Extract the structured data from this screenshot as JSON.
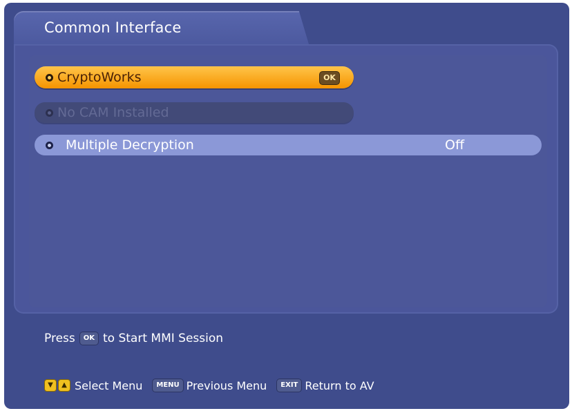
{
  "header": {
    "title": "Common Interface"
  },
  "menu": {
    "items": [
      {
        "label": "CryptoWorks",
        "badge": "OK",
        "state": "selected"
      },
      {
        "label": "No CAM Installed",
        "state": "disabled"
      },
      {
        "label": "Multiple Decryption",
        "value": "Off",
        "state": "normal"
      }
    ]
  },
  "hint": {
    "press": "Press",
    "key": "OK",
    "action": "to Start MMI Session"
  },
  "footer": {
    "select_label": "Select Menu",
    "menu_key": "MENU",
    "previous_label": "Previous Menu",
    "exit_key": "EXIT",
    "return_label": "Return to AV",
    "arrow_down": "▼",
    "arrow_up": "▲"
  },
  "colors": {
    "background": "#3f4c8c",
    "selected": "#f59400",
    "highlight_row": "#8b98d7",
    "disabled_row": "#424a78"
  }
}
